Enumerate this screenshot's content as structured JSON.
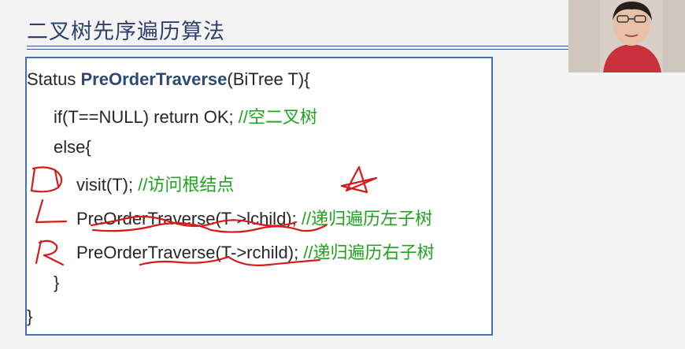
{
  "slide": {
    "title": "二叉树先序遍历算法"
  },
  "code": {
    "line1": {
      "prefix": "Status ",
      "func": "PreOrderTraverse",
      "suffix": "(BiTree T){"
    },
    "line2": {
      "code": "if(T==NULL) return OK; ",
      "comment": "//空二叉树"
    },
    "line3": {
      "code": "else{"
    },
    "line4": {
      "code": "visit(T); ",
      "comment": "//访问根结点"
    },
    "line5": {
      "code": "PreOrderTraverse(T->lchild); ",
      "comment": "//递归遍历左子树"
    },
    "line6": {
      "code": "PreOrderTraverse(T->rchild); ",
      "comment": "//递归遍历右子树"
    },
    "line7": {
      "code": "}"
    },
    "line8": {
      "code": "}"
    }
  },
  "annotations": {
    "ink_color": "#d21c1c",
    "handwritten_letters": [
      "D",
      "L",
      "R"
    ]
  },
  "colors": {
    "title": "#2f4170",
    "box_border": "#4a6ea9",
    "comment": "#1fa31f",
    "keyword": "#2f4a72"
  }
}
